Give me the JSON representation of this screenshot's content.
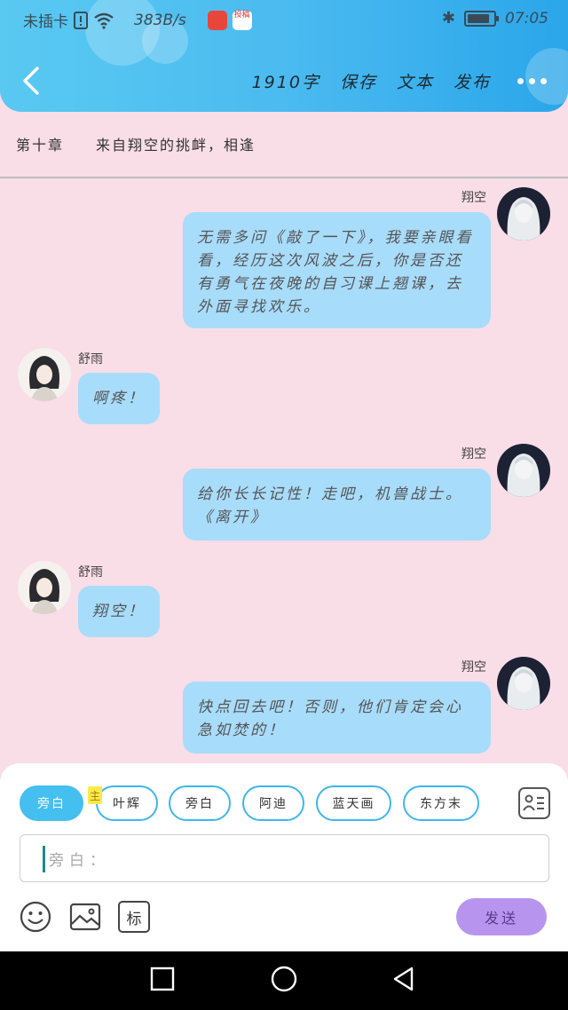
{
  "status_bar": {
    "carrier": "未插卡",
    "speed": "383B/s",
    "app_badge": "投稿",
    "time": "07:05",
    "battery_level": 0.85
  },
  "toolbar": {
    "word_count": "1910字",
    "save_label": "保存",
    "text_label": "文本",
    "publish_label": "发布"
  },
  "chapter": {
    "number": "第十章",
    "title": "来自翔空的挑衅，相逢"
  },
  "messages": [
    {
      "speaker": "翔空",
      "side": "right",
      "text": "无需多问《敲了一下》，我要亲眼看看，经历这次风波之后，你是否还有勇气在夜晚的自习课上翘课，去外面寻找欢乐。"
    },
    {
      "speaker": "舒雨",
      "side": "left",
      "text": "啊疼！"
    },
    {
      "speaker": "翔空",
      "side": "right",
      "text": "给你长长记性！走吧，机兽战士。《离开》"
    },
    {
      "speaker": "舒雨",
      "side": "left",
      "text": "翔空！"
    },
    {
      "speaker": "翔空",
      "side": "right",
      "text": "快点回去吧！否则，他们肯定会心急如焚的！"
    }
  ],
  "chips": [
    {
      "label": "旁白",
      "active": true
    },
    {
      "label": "叶辉",
      "active": false
    },
    {
      "label": "旁白",
      "active": false
    },
    {
      "label": "阿迪",
      "active": false
    },
    {
      "label": "蓝天画",
      "active": false
    },
    {
      "label": "东方末",
      "active": false
    }
  ],
  "main_tag": "主",
  "input": {
    "placeholder": "旁白："
  },
  "tools": {
    "tag_label": "标"
  },
  "send_label": "发送",
  "colors": {
    "header": "#4bbbf0",
    "background": "#f9dde7",
    "bubble": "#a8dcfb",
    "chip_border": "#3fb6ea",
    "send": "#b795ee"
  }
}
